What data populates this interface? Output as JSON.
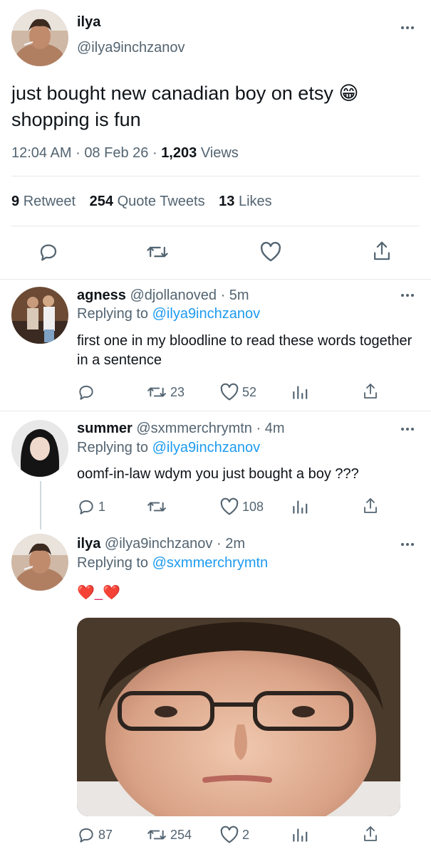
{
  "main_tweet": {
    "display_name": "ilya",
    "handle": "@ilya9inchzanov",
    "text": "just bought new canadian boy on etsy 😁 shopping is fun",
    "time": "12:04 AM",
    "date": "08 Feb 26",
    "views_count": "1,203",
    "views_label": "Views",
    "retweet_count": "9",
    "retweet_label": "Retweet",
    "quote_count": "254",
    "quote_label": "Quote Tweets",
    "likes_count": "13",
    "likes_label": "Likes",
    "sep": "·"
  },
  "replies": [
    {
      "name": "agness",
      "handle": "@djollanoved",
      "age": "5m",
      "replying_label": "Replying to",
      "replying_to": "@ilya9inchzanov",
      "text": "first one in my bloodline to read these words together in a sentence",
      "reply_count": "",
      "retweet_count": "23",
      "like_count": "52"
    },
    {
      "name": "summer",
      "handle": "@sxmmerchrymtn",
      "age": "4m",
      "replying_label": "Replying to",
      "replying_to": "@ilya9inchzanov",
      "text": "oomf-in-law wdym you just bought a boy ???",
      "reply_count": "1",
      "retweet_count": "",
      "like_count": "108"
    },
    {
      "name": "ilya",
      "handle": "@ilya9inchzanov",
      "age": "2m",
      "replying_label": "Replying to",
      "replying_to": "@sxmmerchrymtn",
      "text": "❤️_❤️",
      "reply_count": "87",
      "retweet_count": "254",
      "like_count": "2"
    }
  ],
  "colors": {
    "link": "#1d9bf0",
    "muted": "#536471",
    "text": "#0f1419",
    "divider": "#e6e9ec"
  },
  "icons": [
    "more-icon",
    "reply-icon",
    "retweet-icon",
    "like-icon",
    "share-icon",
    "analytics-icon"
  ]
}
